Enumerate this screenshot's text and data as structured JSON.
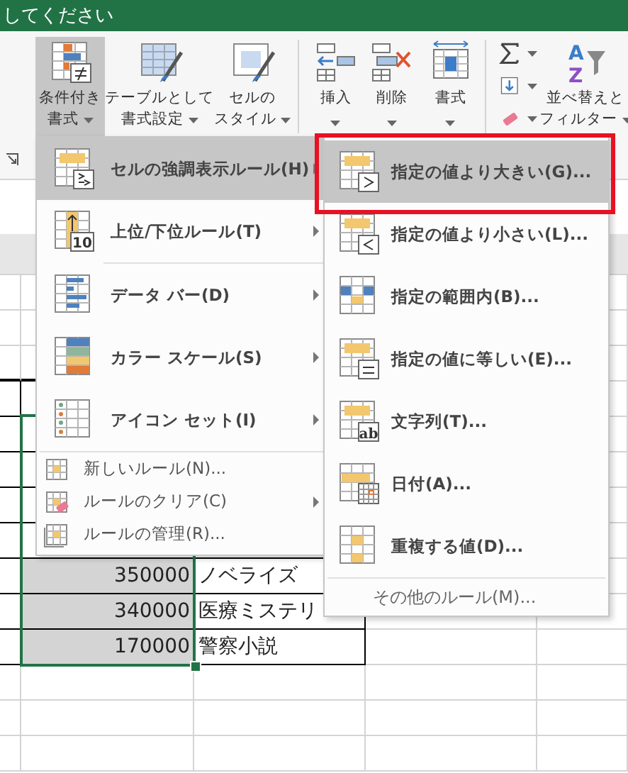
{
  "window": {
    "title": "してください"
  },
  "ribbon": {
    "buttons": [
      {
        "kind": "large",
        "lines": [
          "条件付き",
          "書式"
        ],
        "dropdown": true,
        "selected": true
      },
      {
        "kind": "large",
        "lines": [
          "テーブルとして",
          "書式設定"
        ],
        "dropdown": true,
        "selected": false
      },
      {
        "kind": "large",
        "lines": [
          "セルの",
          "スタイル"
        ],
        "dropdown": true,
        "selected": false
      },
      {
        "kind": "separator"
      },
      {
        "kind": "large",
        "lines": [
          "挿入"
        ],
        "dropdown": true,
        "selected": false
      },
      {
        "kind": "large",
        "lines": [
          "削除"
        ],
        "dropdown": true,
        "selected": false
      },
      {
        "kind": "large",
        "lines": [
          "書式"
        ],
        "dropdown": true,
        "selected": false
      },
      {
        "kind": "separator"
      },
      {
        "kind": "stack",
        "items": [
          {
            "dropdown": true
          },
          {
            "dropdown": true
          },
          {
            "dropdown": true
          }
        ]
      },
      {
        "kind": "large",
        "badge": [
          "A",
          "Z"
        ],
        "lines": [
          "並べ替えと",
          "フィルター"
        ],
        "dropdown": true,
        "selected": false
      }
    ]
  },
  "menu": {
    "items": [
      {
        "kind": "highlight",
        "label": "セルの強調表示ルール(H)",
        "submenu": true,
        "selected": true
      },
      {
        "kind": "topbottom",
        "badge": "10",
        "label": "上位/下位ルール(T)",
        "submenu": true,
        "selected": false
      },
      {
        "kind": "databar",
        "label": "データ バー(D)",
        "submenu": true,
        "selected": false
      },
      {
        "kind": "colorscale",
        "label": "カラー スケール(S)",
        "submenu": true,
        "selected": false
      },
      {
        "kind": "iconset",
        "label": "アイコン セット(I)",
        "submenu": true,
        "selected": false
      },
      {
        "kind": "newrule",
        "label": "新しいルール(N)...",
        "submenu": false,
        "selected": false
      },
      {
        "kind": "clear",
        "label": "ルールのクリア(C)",
        "submenu": true,
        "selected": false
      },
      {
        "kind": "manage",
        "label": "ルールの管理(R)...",
        "submenu": false,
        "selected": false
      }
    ]
  },
  "submenu": {
    "items": [
      {
        "kind": "greater",
        "label": "指定の値より大きい(G)...",
        "selected": true,
        "outlined": true
      },
      {
        "kind": "less",
        "label": "指定の値より小さい(L)...",
        "selected": false,
        "outlined": false
      },
      {
        "kind": "between",
        "label": "指定の範囲内(B)...",
        "selected": false,
        "outlined": false
      },
      {
        "kind": "equal",
        "label": "指定の値に等しい(E)...",
        "selected": false,
        "outlined": false
      },
      {
        "kind": "text",
        "badge": "ab",
        "label": "文字列(T)...",
        "selected": false,
        "outlined": false
      },
      {
        "kind": "date",
        "label": "日付(A)...",
        "selected": false,
        "outlined": false
      },
      {
        "kind": "duplicate",
        "label": "重複する値(D)...",
        "selected": false,
        "outlined": false
      }
    ],
    "footer": "その他のルール(M)..."
  },
  "sheet": {
    "rows": [
      {
        "number": "350000",
        "text": "ノベライズ",
        "selected": true
      },
      {
        "number": "340000",
        "text": "医療ミステリ",
        "selected": true
      },
      {
        "number": "170000",
        "text": "警察小説",
        "selected": true
      }
    ]
  }
}
